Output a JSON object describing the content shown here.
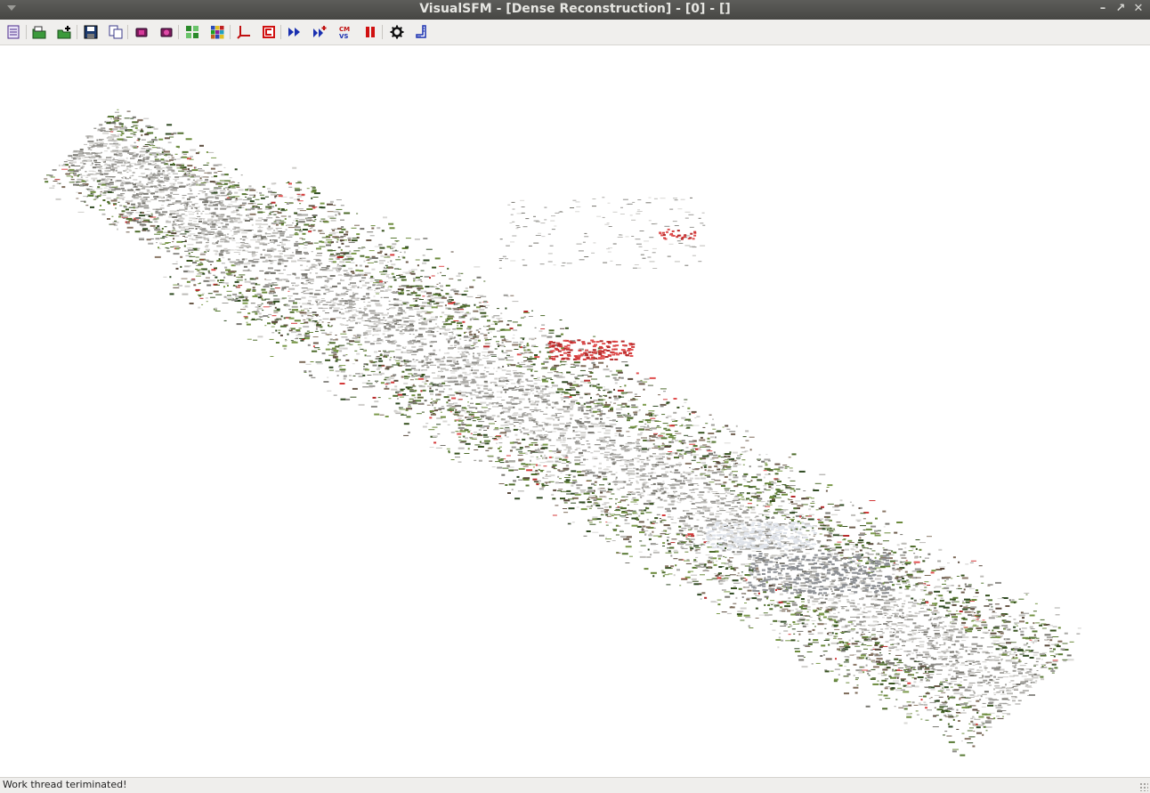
{
  "window": {
    "title": "VisualSFM - [Dense Reconstruction] - [0] - []",
    "buttons": [
      "minimize",
      "maximize",
      "close"
    ]
  },
  "toolbar": {
    "icons": [
      "log-window-icon",
      "open-images-icon",
      "open-add-images-icon",
      "save-nview-match-icon",
      "copy-icon",
      "show-2d-icon",
      "show-3d-icon",
      "compute-missing-match-icon",
      "pairwise-matrix-icon",
      "compute-3d-reconstruction-icon",
      "stop-icon",
      "run-dense-reconstruction-icon",
      "reconstruct-resume-icon",
      "cmvs-icon",
      "pause-icon",
      "settings-gear-icon",
      "ruler-icon"
    ]
  },
  "viewport": {
    "content": "dense-point-cloud",
    "background": "#ffffff"
  },
  "status": {
    "message": "Work thread teriminated!"
  }
}
